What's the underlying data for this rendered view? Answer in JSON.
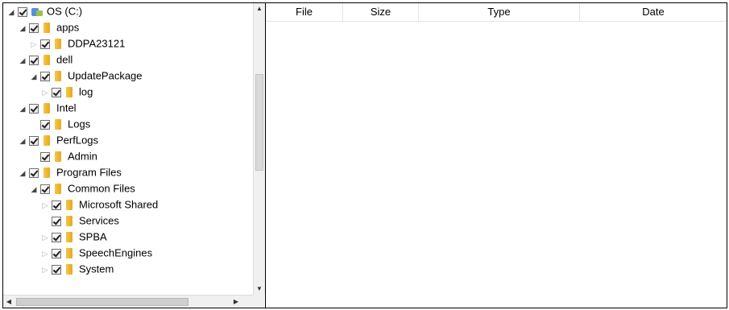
{
  "tree": {
    "items": [
      {
        "label": "OS (C:)",
        "icon": "drive-icon",
        "expander": "expanded",
        "level": 0,
        "checked": true
      },
      {
        "label": "apps",
        "icon": "folder-icon",
        "expander": "expanded",
        "level": 1,
        "checked": true
      },
      {
        "label": "DDPA23121",
        "icon": "folder-icon",
        "expander": "collapsed",
        "level": 2,
        "checked": true
      },
      {
        "label": "dell",
        "icon": "folder-icon",
        "expander": "expanded",
        "level": 1,
        "checked": true
      },
      {
        "label": "UpdatePackage",
        "icon": "folder-icon",
        "expander": "expanded",
        "level": 2,
        "checked": true
      },
      {
        "label": "log",
        "icon": "folder-icon",
        "expander": "collapsed",
        "level": 3,
        "checked": true
      },
      {
        "label": "Intel",
        "icon": "folder-icon",
        "expander": "expanded",
        "level": 1,
        "checked": true
      },
      {
        "label": "Logs",
        "icon": "folder-icon",
        "expander": "none",
        "level": 2,
        "checked": true
      },
      {
        "label": "PerfLogs",
        "icon": "folder-icon",
        "expander": "expanded",
        "level": 1,
        "checked": true
      },
      {
        "label": "Admin",
        "icon": "folder-icon",
        "expander": "none",
        "level": 2,
        "checked": true
      },
      {
        "label": "Program Files",
        "icon": "folder-icon",
        "expander": "expanded",
        "level": 1,
        "checked": true
      },
      {
        "label": "Common Files",
        "icon": "folder-icon",
        "expander": "expanded",
        "level": 2,
        "checked": true
      },
      {
        "label": "Microsoft Shared",
        "icon": "folder-icon",
        "expander": "collapsed",
        "level": 3,
        "checked": true
      },
      {
        "label": "Services",
        "icon": "folder-icon",
        "expander": "none",
        "level": 3,
        "checked": true
      },
      {
        "label": "SPBA",
        "icon": "folder-icon",
        "expander": "collapsed",
        "level": 3,
        "checked": true
      },
      {
        "label": "SpeechEngines",
        "icon": "folder-icon",
        "expander": "collapsed",
        "level": 3,
        "checked": true
      },
      {
        "label": "System",
        "icon": "folder-icon",
        "expander": "collapsed",
        "level": 3,
        "checked": true
      }
    ]
  },
  "table": {
    "columns": [
      "File",
      "Size",
      "Type",
      "Date"
    ],
    "rows": []
  },
  "icons": {
    "expanded": "◢",
    "collapsed": "▷",
    "scroll_up": "▲",
    "scroll_down": "▼",
    "scroll_left": "◀",
    "scroll_right": "▶"
  },
  "colors": {
    "folder": "#e8a91e",
    "border": "#000000",
    "scrollbar": "#f0f0f0"
  }
}
